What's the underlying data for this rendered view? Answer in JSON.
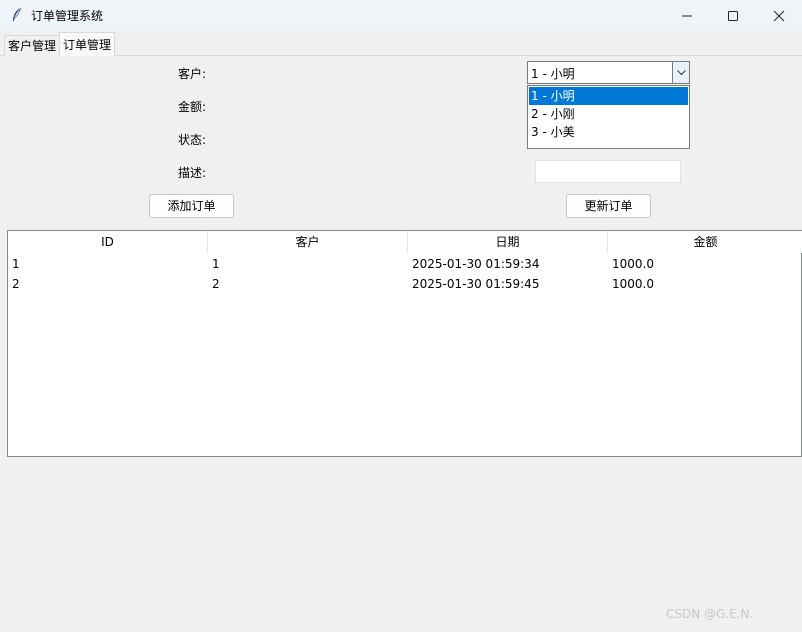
{
  "window": {
    "title": "订单管理系统"
  },
  "tabs": [
    {
      "label": "客户管理"
    },
    {
      "label": "订单管理"
    }
  ],
  "form": {
    "customer_label": "客户:",
    "amount_label": "金额:",
    "status_label": "状态:",
    "desc_label": "描述:",
    "customer_value": "1 - 小明",
    "customer_options": [
      "1 - 小明",
      "2 - 小刚",
      "3 - 小美"
    ],
    "description_value": ""
  },
  "buttons": {
    "add_order": "添加订单",
    "update_order": "更新订单"
  },
  "table": {
    "columns": [
      "ID",
      "客户",
      "日期",
      "金额"
    ],
    "rows": [
      [
        "1",
        "1",
        "2025-01-30 01:59:34",
        "1000.0"
      ],
      [
        "2",
        "2",
        "2025-01-30 01:59:45",
        "1000.0"
      ]
    ]
  },
  "watermark": "CSDN @G.E.N.",
  "colors": {
    "selection": "#0078d7",
    "titlebar": "#eff4f9",
    "window_bg": "#f0f0f0"
  }
}
